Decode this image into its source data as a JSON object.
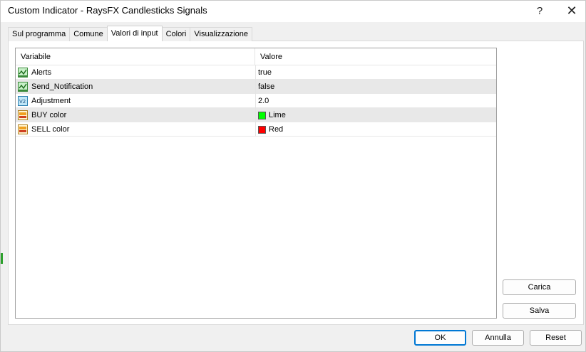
{
  "window": {
    "title": "Custom Indicator - RaysFX Candlesticks Signals",
    "help_glyph": "?",
    "close_glyph": "✕"
  },
  "tabs": [
    {
      "label": "Sul programma"
    },
    {
      "label": "Comune"
    },
    {
      "label": "Valori di input",
      "active": true
    },
    {
      "label": "Colori"
    },
    {
      "label": "Visualizzazione"
    }
  ],
  "grid": {
    "columns": {
      "variable": "Variabile",
      "value": "Valore"
    },
    "rows": [
      {
        "name": "Alerts",
        "value": "true",
        "icon": "bool-icon"
      },
      {
        "name": "Send_Notification",
        "value": "false",
        "icon": "bool-icon"
      },
      {
        "name": "Adjustment",
        "value": "2.0",
        "icon": "value-icon"
      },
      {
        "name": "BUY color",
        "value": "Lime",
        "icon": "color-icon",
        "swatch": "#00ff00"
      },
      {
        "name": "SELL color",
        "value": "Red",
        "icon": "color-icon",
        "swatch": "#ff0000"
      }
    ]
  },
  "buttons": {
    "load": "Carica",
    "save": "Salva",
    "ok": "OK",
    "cancel": "Annulla",
    "reset": "Reset"
  },
  "colors": {
    "accent": "#0078d4",
    "row_alt": "#e8e8e8"
  }
}
